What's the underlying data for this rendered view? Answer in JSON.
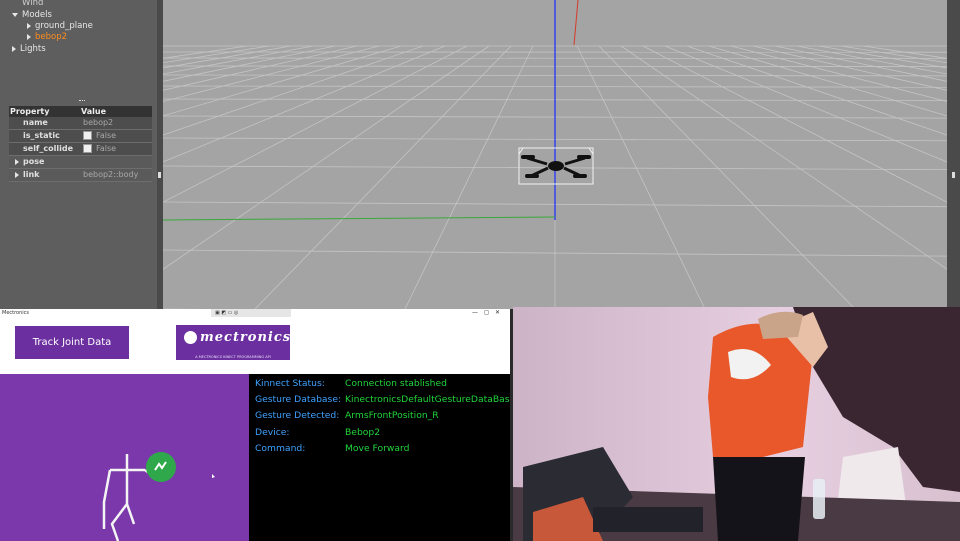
{
  "gazebo": {
    "world_tree": {
      "items": [
        {
          "label": "Wind",
          "level": 0,
          "arrow": "none"
        },
        {
          "label": "Models",
          "level": 0,
          "arrow": "down"
        },
        {
          "label": "ground_plane",
          "level": 1,
          "arrow": "right"
        },
        {
          "label": "bebop2",
          "level": 1,
          "arrow": "right",
          "selected": true
        },
        {
          "label": "Lights",
          "level": 0,
          "arrow": "right"
        }
      ]
    },
    "properties": {
      "header_property": "Property",
      "header_value": "Value",
      "rows": [
        {
          "name": "name",
          "value": "bebop2",
          "checkbox": false
        },
        {
          "name": "is_static",
          "value": "False",
          "checkbox": true
        },
        {
          "name": "self_collide",
          "value": "False",
          "checkbox": true
        },
        {
          "name": "pose",
          "value": "",
          "expandable": true
        },
        {
          "name": "link",
          "value": "bebop2::body",
          "expandable": true
        }
      ]
    },
    "colors": {
      "selected": "#ff8c1a",
      "panel": "#5e5e5e",
      "floor": "#a4a4a4"
    }
  },
  "app": {
    "title": "Mectronics",
    "window_controls": [
      "—",
      "◻",
      "✕"
    ],
    "track_button_label": "Track Joint Data",
    "logo": {
      "word": "mectronics",
      "subtitle": "A MECTRONICS KINECT PROGRAMMING API"
    },
    "status": [
      {
        "label": "Kinnect Status:",
        "value": "Connection stablished"
      },
      {
        "label": "Gesture Database:",
        "value": "KinectronicsDefaultGestureDataBase"
      },
      {
        "label": "Gesture Detected:",
        "value": "ArmsFrontPosition_R"
      },
      {
        "label": "Device:",
        "value": "Bebop2"
      },
      {
        "label": "Command:",
        "value": "Move Forward"
      }
    ],
    "colors": {
      "accent": "#6b2fa0",
      "label": "#3ea1ff",
      "value": "#21d43a"
    }
  },
  "webcam": {
    "description_icon": "camera-feed"
  }
}
